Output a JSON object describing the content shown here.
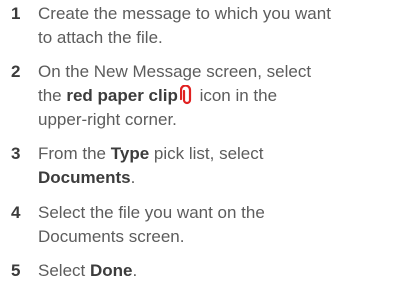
{
  "steps": [
    {
      "num": "1",
      "line1": "Create the message to which you want",
      "line2": "to attach the file."
    },
    {
      "num": "2",
      "pre": "On the New Message screen, select",
      "mid1": "the ",
      "bold": "red paper clip",
      "post": " icon in the",
      "line3": "upper-right corner.",
      "icon": "paperclip-icon",
      "icon_color": "#e02020"
    },
    {
      "num": "3",
      "pre": "From the ",
      "bold1": "Type",
      "mid": " pick list, select",
      "bold2": "Documents",
      "end": "."
    },
    {
      "num": "4",
      "line1": "Select the file you want on the",
      "line2": "Documents screen."
    },
    {
      "num": "5",
      "pre": "Select ",
      "bold": "Done",
      "end": "."
    }
  ]
}
